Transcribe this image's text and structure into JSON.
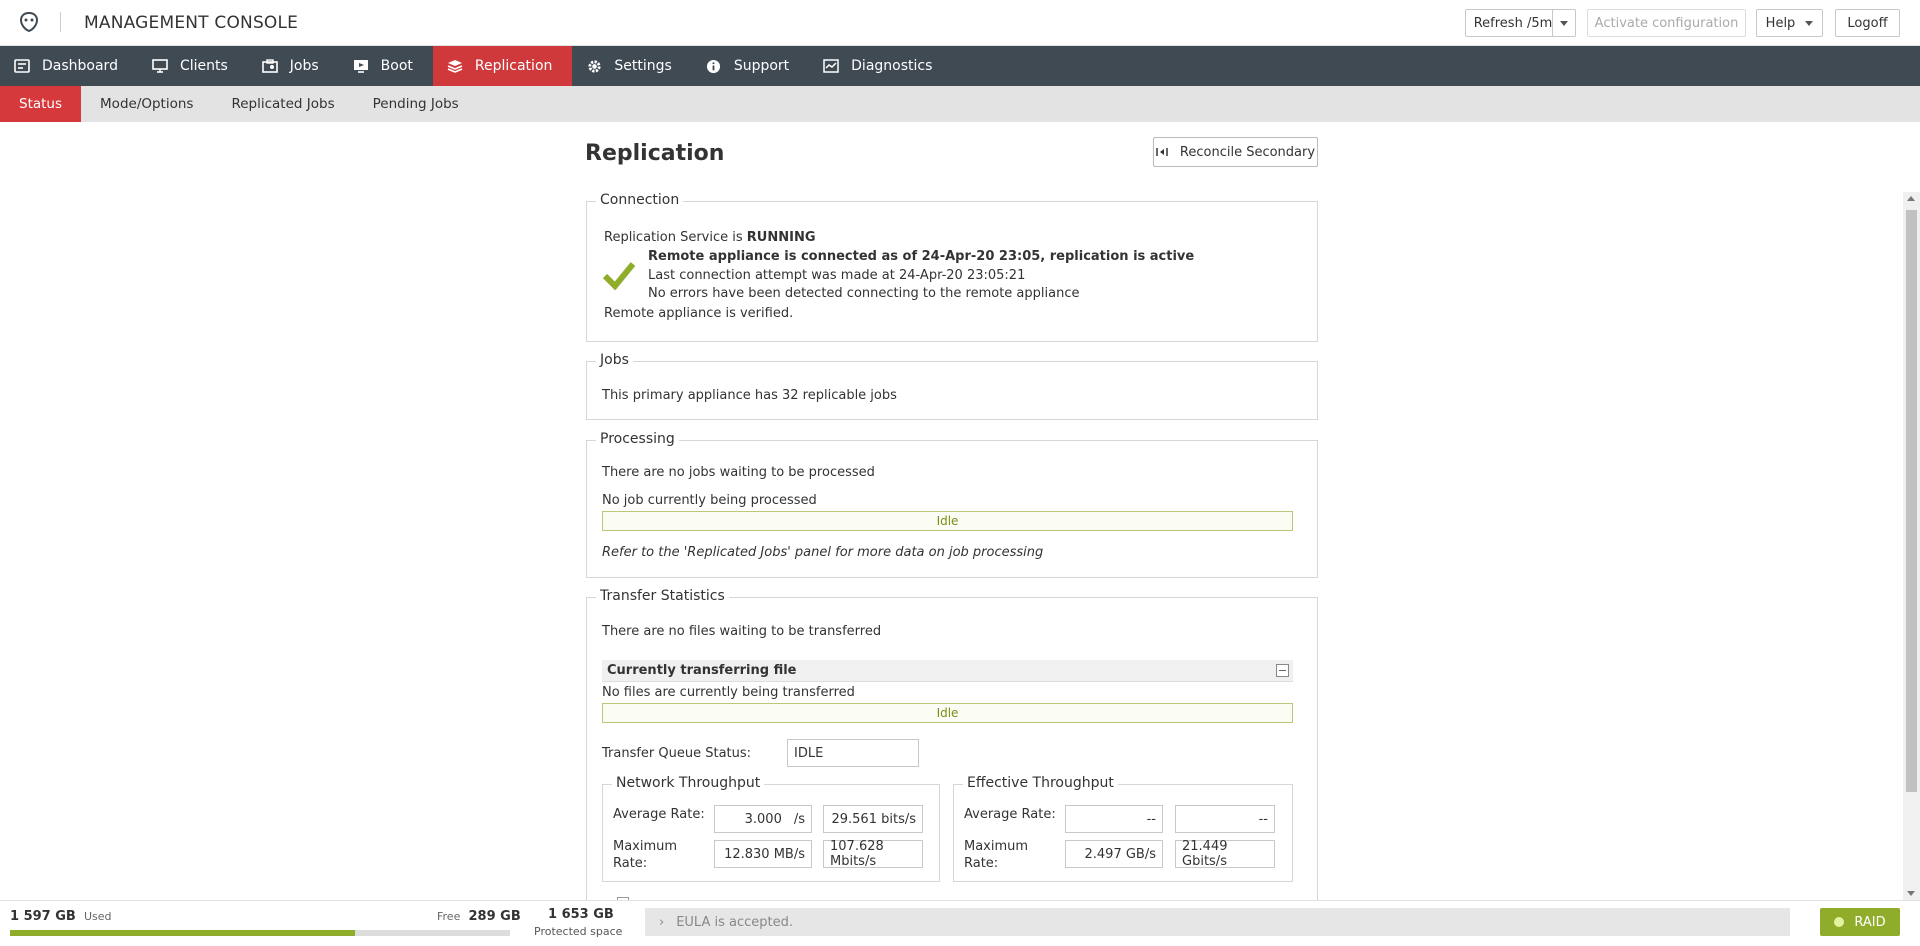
{
  "header": {
    "title": "MANAGEMENT CONSOLE",
    "refresh_label": "Refresh /5m",
    "activate_label": "Activate configuration",
    "help_label": "Help",
    "logoff_label": "Logoff"
  },
  "nav": {
    "items": [
      {
        "label": "Dashboard",
        "icon": "dashboard-icon"
      },
      {
        "label": "Clients",
        "icon": "monitor-icon"
      },
      {
        "label": "Jobs",
        "icon": "jobs-icon"
      },
      {
        "label": "Boot",
        "icon": "boot-icon"
      },
      {
        "label": "Replication",
        "icon": "replication-icon",
        "active": true
      },
      {
        "label": "Settings",
        "icon": "gear-icon"
      },
      {
        "label": "Support",
        "icon": "info-icon"
      },
      {
        "label": "Diagnostics",
        "icon": "diagnostics-icon"
      }
    ]
  },
  "subnav": {
    "items": [
      "Status",
      "Mode/Options",
      "Replicated Jobs",
      "Pending Jobs"
    ]
  },
  "main": {
    "title": "Replication",
    "reconcile_label": "Reconcile Secondary",
    "connection": {
      "legend": "Connection",
      "service_prefix": "Replication Service is",
      "service_state": "RUNNING",
      "status_line": "Remote appliance is connected as of 24-Apr-20 23:05, replication is active",
      "last_attempt": "Last connection attempt was made at 24-Apr-20 23:05:21",
      "errors": "No errors have been detected connecting to the remote appliance",
      "verified": "Remote appliance is verified."
    },
    "jobs": {
      "legend": "Jobs",
      "text": "This primary appliance has 32 replicable jobs"
    },
    "processing": {
      "legend": "Processing",
      "waiting": "There are no jobs waiting to be processed",
      "current": "No job currently being processed",
      "idle": "Idle",
      "note": "Refer to the 'Replicated Jobs' panel for more data on job processing"
    },
    "transfer": {
      "legend": "Transfer Statistics",
      "waiting": "There are no files waiting to be transferred",
      "current_header": "Currently transferring file",
      "current": "No files are currently being transferred",
      "idle": "Idle",
      "queue_label": "Transfer Queue Status:",
      "queue_value": "IDLE",
      "network": {
        "legend": "Network Throughput",
        "avg_label": "Average Rate:",
        "avg_value_1": "3.000",
        "avg_unit_1": "/s",
        "avg_value_2": "29.561  bits/s",
        "max_label_1": "Maximum",
        "max_label_2": "Rate:",
        "max_value_1": "12.830 MB/s",
        "max_value_2": "107.628 Mbits/s"
      },
      "effective": {
        "legend": "Effective Throughput",
        "avg_label": "Average Rate:",
        "avg_value_1": "--",
        "avg_value_2": "--",
        "max_label_1": "Maximum",
        "max_label_2": "Rate:",
        "max_value_1": "2.497 GB/s",
        "max_value_2": "21.449 Gbits/s"
      }
    }
  },
  "footer": {
    "used_value": "1 597 GB",
    "used_label": "Used",
    "free_label": "Free",
    "free_value": "289 GB",
    "protected_value": "1 653 GB",
    "protected_label": "Protected space",
    "usage_fraction": 0.69,
    "eula": "EULA is accepted.",
    "raid_label": "RAID"
  },
  "colors": {
    "nav_bg": "#3f4a53",
    "accent_red": "#d0393b",
    "ok_green": "#8fad2b"
  }
}
